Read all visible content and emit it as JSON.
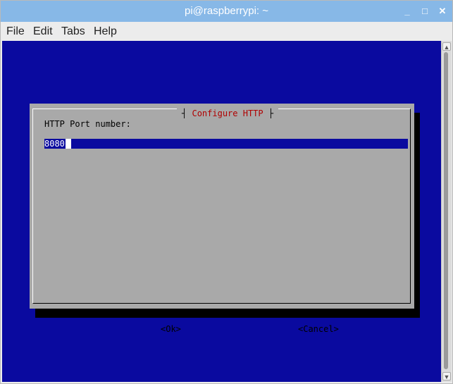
{
  "window": {
    "title": "pi@raspberrypi: ~",
    "minimize_glyph": "_",
    "maximize_glyph": "□",
    "close_glyph": "✕"
  },
  "menubar": {
    "items": [
      "File",
      "Edit",
      "Tabs",
      "Help"
    ]
  },
  "dialog": {
    "title": "Configure HTTP",
    "field_label": "HTTP Port number:",
    "port_value": "8080",
    "ok_label": "<Ok>",
    "cancel_label": "<Cancel>"
  },
  "colors": {
    "titlebar": "#87b8e7",
    "terminal_background": "#0a0a9f",
    "dialog_background": "#a9a9a9",
    "dialog_title": "#b00000"
  },
  "icons": {
    "scroll_up": "▲",
    "scroll_down": "▼"
  }
}
